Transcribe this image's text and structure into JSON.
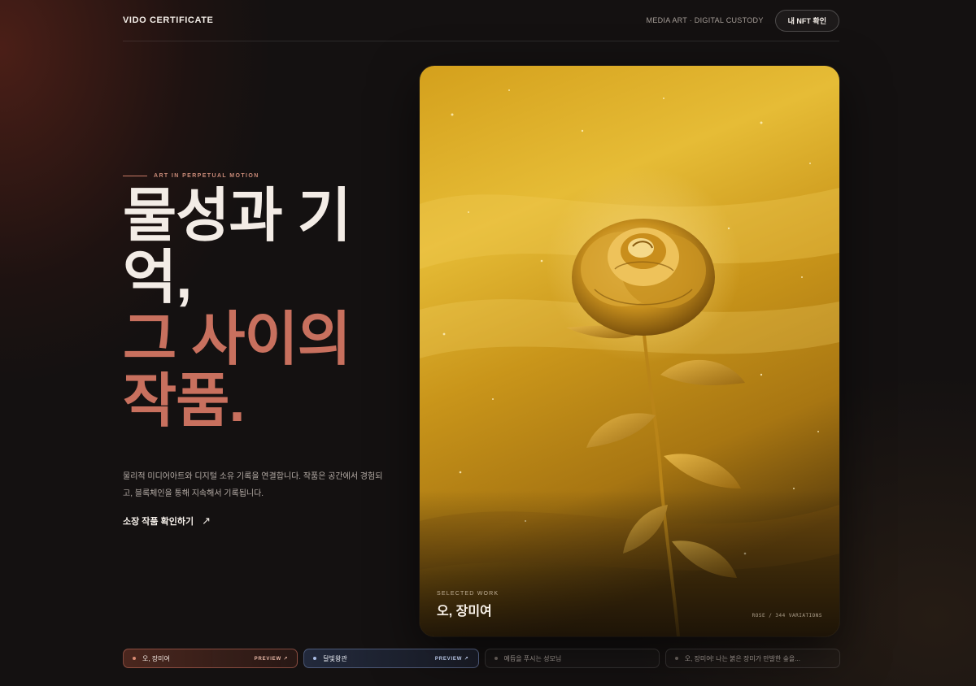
{
  "header": {
    "logo": "VIDO CERTIFICATE",
    "tagline": "MEDIA ART · DIGITAL CUSTODY",
    "nft_button": "내 NFT 확인"
  },
  "hero": {
    "eyebrow": "ART IN PERPETUAL MOTION",
    "headline_line1": "물성과 기억,",
    "headline_line2": "그 사이의 작품.",
    "description": "물리적 미디어아트와 디지털 소유 기록을 연결합니다. 작품은 공간에서 경험되고, 블록체인을 통해 지속해서 기록됩니다.",
    "cta_label": "소장 작품 확인하기",
    "cta_icon": "↗"
  },
  "featured": {
    "eyebrow": "SELECTED WORK",
    "title": "오, 장미여",
    "meta": "ROSE / 344 VARIATIONS",
    "image_icon": "golden-rose-artwork"
  },
  "works": [
    {
      "label": "오, 장미여",
      "preview": "PREVIEW ↗"
    },
    {
      "label": "달빛왕관",
      "preview": "PREVIEW ↗"
    },
    {
      "label": "예듭을 푸시는 성모님",
      "preview": ""
    },
    {
      "label": "오, 장미여! 나는 붉은 장미가 만발한 숲을...",
      "preview": ""
    }
  ],
  "colors": {
    "background": "#141111",
    "accent": "#c8705e",
    "gold": "#d9a92a"
  }
}
